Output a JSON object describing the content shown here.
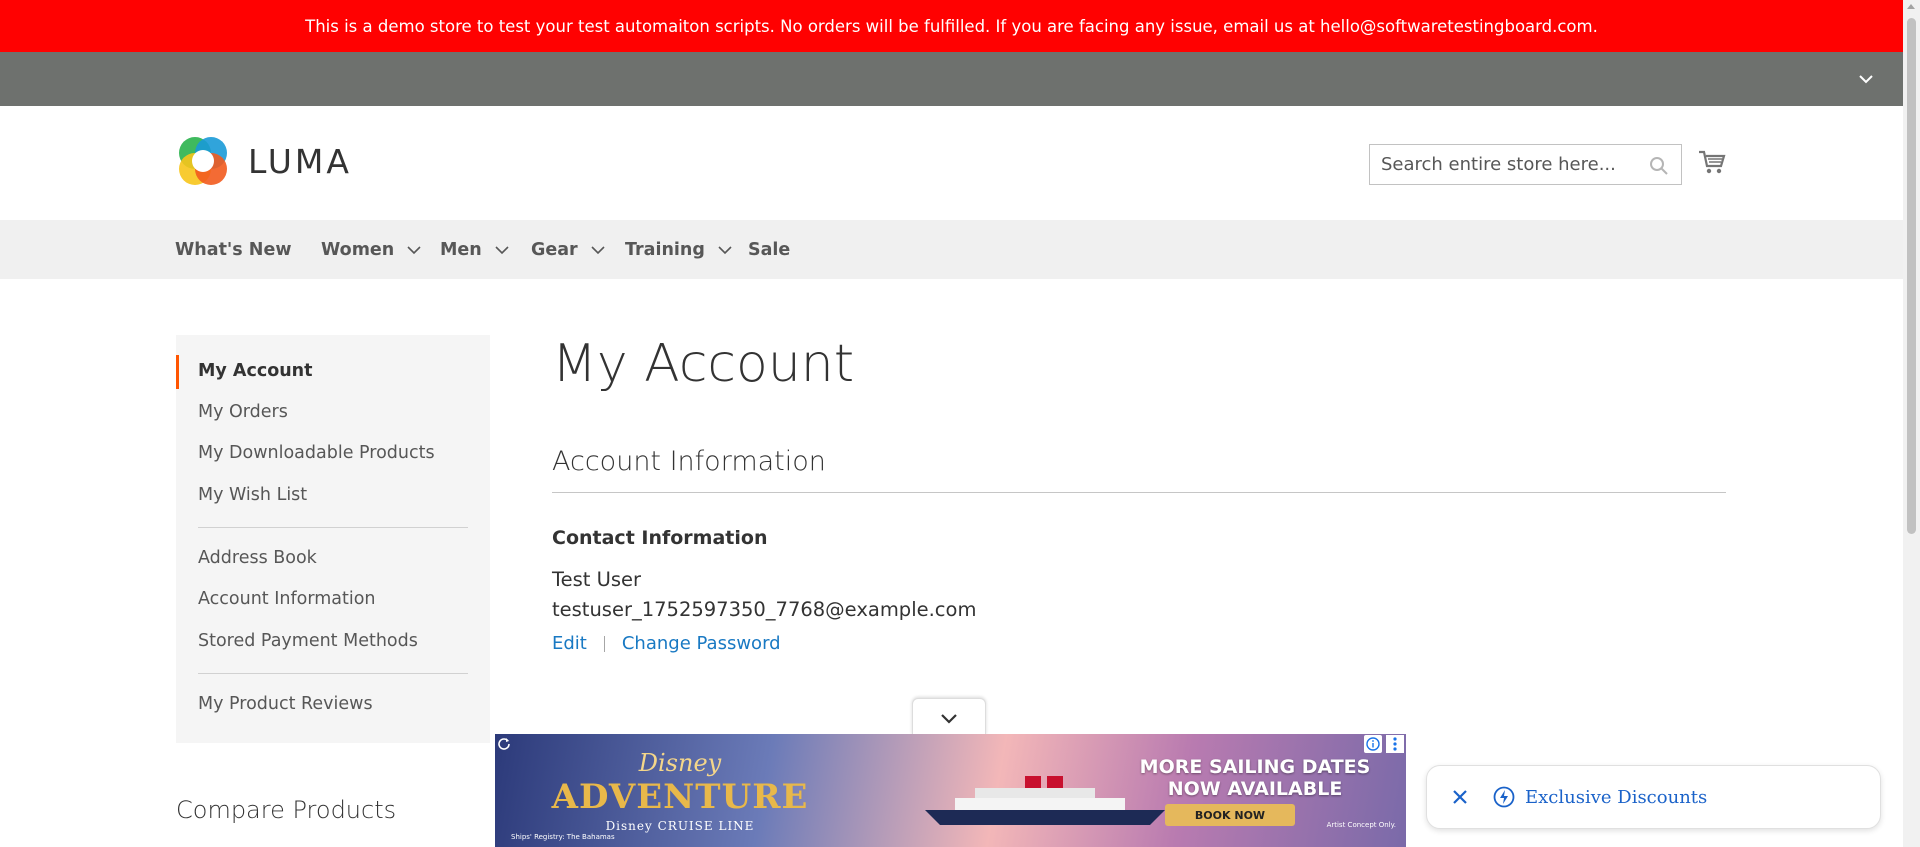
{
  "demo_banner": {
    "text": "This is a demo store to test your test automaiton scripts. No orders will be fulfilled. If you are facing any issue, email us at hello@softwaretestingboard.com."
  },
  "header": {
    "logo_text": "LUMA",
    "search_placeholder": "Search entire store here...",
    "search_value": ""
  },
  "nav": {
    "items": [
      {
        "label": "What's New",
        "has_dropdown": false
      },
      {
        "label": "Women",
        "has_dropdown": true
      },
      {
        "label": "Men",
        "has_dropdown": true
      },
      {
        "label": "Gear",
        "has_dropdown": true
      },
      {
        "label": "Training",
        "has_dropdown": true
      },
      {
        "label": "Sale",
        "has_dropdown": false
      }
    ]
  },
  "sidebar": {
    "items": [
      {
        "label": "My Account",
        "active": true
      },
      {
        "label": "My Orders"
      },
      {
        "label": "My Downloadable Products"
      },
      {
        "label": "My Wish List"
      },
      {
        "label": "Address Book"
      },
      {
        "label": "Account Information"
      },
      {
        "label": "Stored Payment Methods"
      },
      {
        "label": "My Product Reviews"
      }
    ],
    "compare_title": "Compare Products"
  },
  "main": {
    "page_title": "My Account",
    "section_title": "Account Information",
    "contact": {
      "title": "Contact Information",
      "name": "Test User",
      "email": "testuser_1752597350_7768@example.com",
      "edit_label": "Edit",
      "change_password_label": "Change Password"
    }
  },
  "ad": {
    "brand": "Disney",
    "product": "ADVENTURE",
    "sub": "Disney CRUISE LINE",
    "headline": "MORE SAILING DATES NOW AVAILABLE",
    "cta": "BOOK NOW",
    "footnote": "Ships' Registry: The Bahamas",
    "fine": "Artist Concept Only."
  },
  "discount_widget": {
    "label": "Exclusive Discounts"
  },
  "colors": {
    "banner_red": "#ff0101",
    "panel_gray": "#6e716e",
    "nav_bg": "#f0f0f0",
    "link_blue": "#1979c3",
    "active_orange": "#ff5501"
  }
}
